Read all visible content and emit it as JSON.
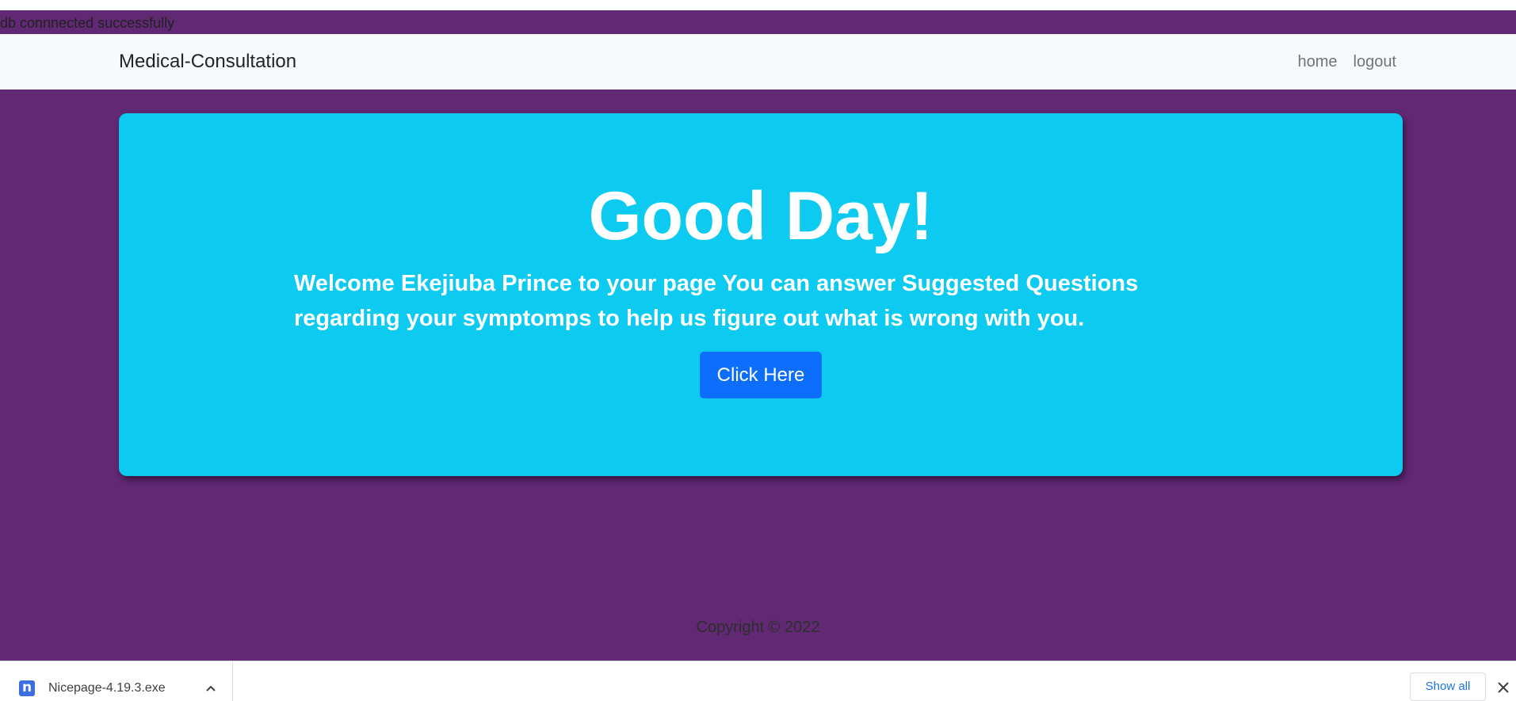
{
  "status_message": "db connnected successfully",
  "navbar": {
    "brand": "Medical-Consultation",
    "links": [
      {
        "label": "home"
      },
      {
        "label": "logout"
      }
    ]
  },
  "hero": {
    "title": "Good Day!",
    "text": "Welcome Ekejiuba Prince to your page You can answer Suggested Questions regarding your symptomps to help us figure out what is wrong with you.",
    "button_label": "Click Here"
  },
  "footer": {
    "copyright": "Copyright © 2022"
  },
  "download_bar": {
    "file_name": "Nicepage-4.19.3.exe",
    "file_icon_letter": "n",
    "show_all_label": "Show all"
  },
  "colors": {
    "page_background": "#612874",
    "navbar_background": "#f8f9fa",
    "hero_background": "#0dcaf0",
    "button_background": "#0d6efd",
    "download_accent": "#1a73e8"
  },
  "icons": {
    "file_icon": "nicepage-file-icon",
    "chevron": "chevron-up-icon",
    "close": "close-icon"
  }
}
